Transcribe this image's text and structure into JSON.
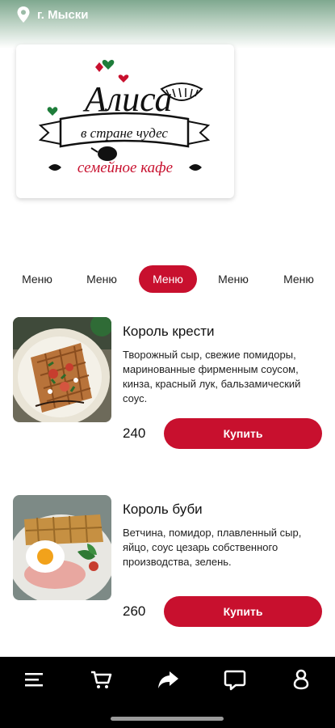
{
  "location": {
    "city": "г. Мыски"
  },
  "logo": {
    "name_line": "Алиса",
    "banner_line": "в стране чудес",
    "subtitle": "семейное кафе"
  },
  "tabs": [
    {
      "label": "Меню",
      "active": false
    },
    {
      "label": "Меню",
      "active": false
    },
    {
      "label": "Меню",
      "active": true
    },
    {
      "label": "Меню",
      "active": false
    },
    {
      "label": "Меню",
      "active": false
    }
  ],
  "products": [
    {
      "title": "Король крести",
      "description": "Творожный сыр, свежие помидоры, маринованные фирменным соусом, кинза, красный лук, бальзамический соус.",
      "price": "240",
      "buy_label": "Купить"
    },
    {
      "title": "Король буби",
      "description": "Ветчина, помидор, плавленный сыр, яйцо, соус цезарь собственного производства, зелень.",
      "price": "260",
      "buy_label": "Купить"
    }
  ],
  "bottom_nav": [
    {
      "icon": "menu-icon"
    },
    {
      "icon": "cart-icon"
    },
    {
      "icon": "share-icon"
    },
    {
      "icon": "chat-icon"
    },
    {
      "icon": "profile-icon"
    }
  ],
  "colors": {
    "accent": "#c8102e",
    "nav_background": "#000000"
  }
}
